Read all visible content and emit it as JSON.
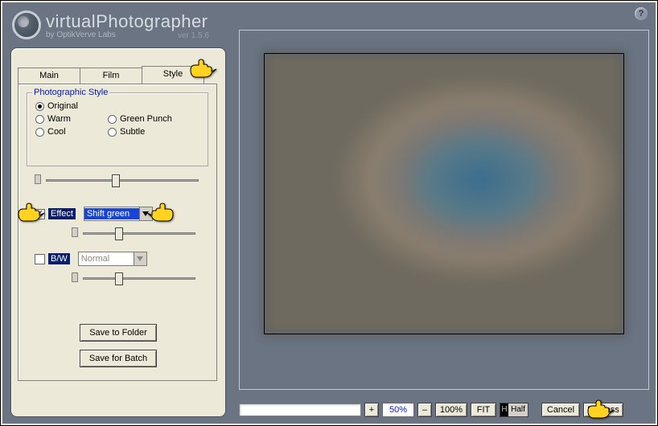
{
  "app": {
    "title": "virtualPhotographer",
    "subtitle": "by OptikVerve Labs",
    "version": "ver 1.5.6"
  },
  "tabs": [
    {
      "label": "Main",
      "active": false
    },
    {
      "label": "Film",
      "active": false
    },
    {
      "label": "Style",
      "active": true
    }
  ],
  "style_panel": {
    "legend": "Photographic Style",
    "radios": {
      "original": "Original",
      "warm": "Warm",
      "cool": "Cool",
      "green_punch": "Green Punch",
      "subtle": "Subtle"
    },
    "selected_radio": "original",
    "effect": {
      "checked": true,
      "label": "Effect",
      "value": "Shift green"
    },
    "bw": {
      "checked": false,
      "label": "B/W",
      "value": "Normal"
    }
  },
  "buttons": {
    "save_folder": "Save to Folder",
    "save_batch": "Save for Batch",
    "cancel": "Cancel",
    "process": "Process",
    "fit": "FIT",
    "half_h": "H",
    "half_t": "Half",
    "hundred": "100%",
    "plus": "+",
    "minus": "–"
  },
  "zoom": {
    "value": "50%"
  }
}
